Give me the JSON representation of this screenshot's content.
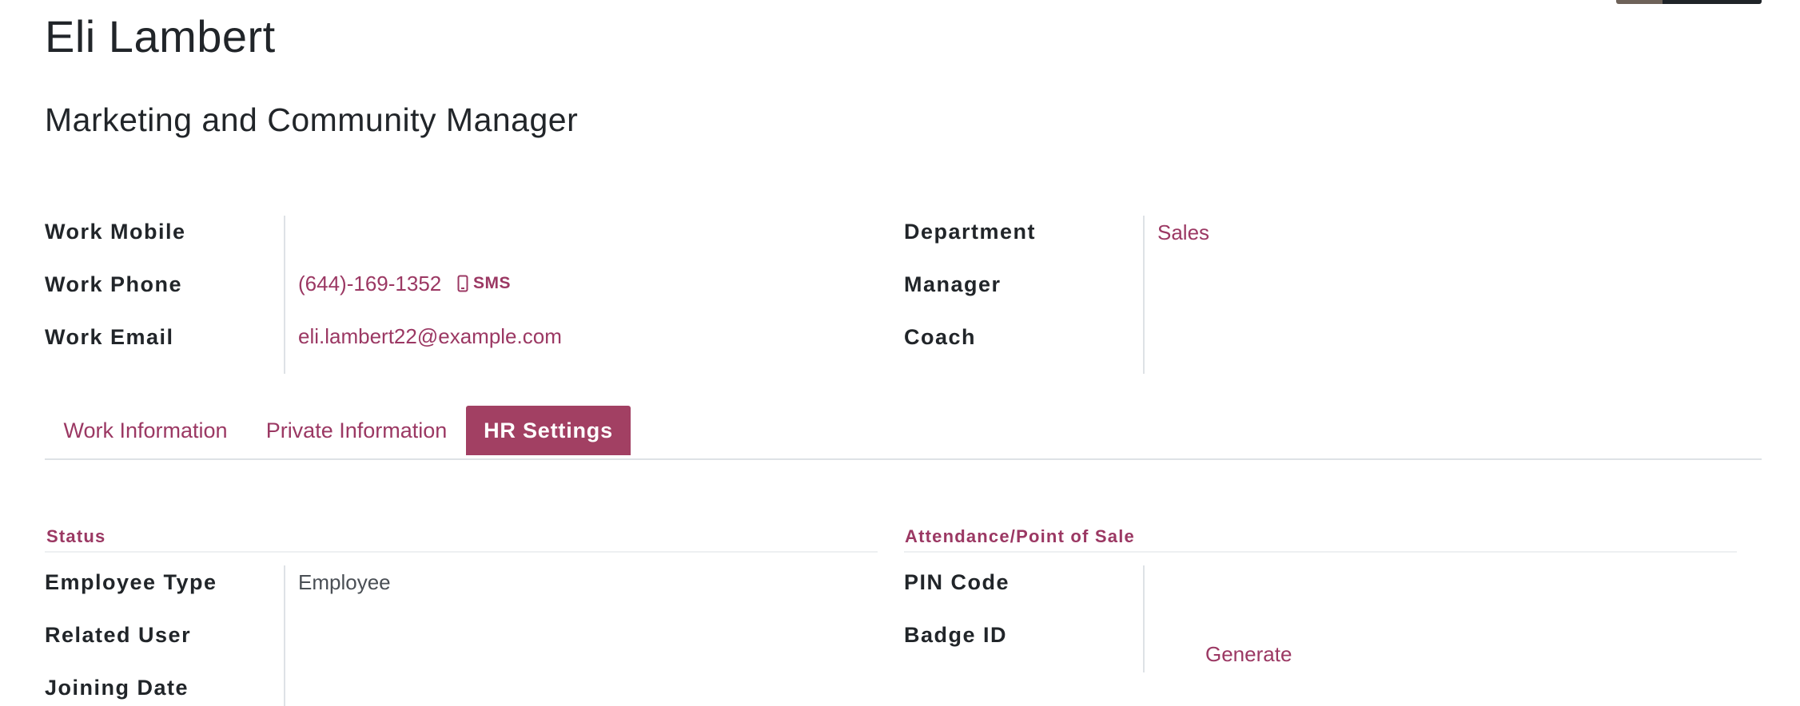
{
  "employee": {
    "name": "Eli Lambert",
    "job_title": "Marketing and Community Manager"
  },
  "contact": {
    "work_mobile_label": "Work Mobile",
    "work_mobile_value": "",
    "work_phone_label": "Work Phone",
    "work_phone_value": "(644)-169-1352",
    "sms_label": "SMS",
    "work_email_label": "Work Email",
    "work_email_value": "eli.lambert22@example.com"
  },
  "org": {
    "department_label": "Department",
    "department_value": "Sales",
    "manager_label": "Manager",
    "manager_value": "",
    "coach_label": "Coach",
    "coach_value": ""
  },
  "tabs": [
    {
      "label": "Work Information",
      "active": false
    },
    {
      "label": "Private Information",
      "active": false
    },
    {
      "label": "HR Settings",
      "active": true
    }
  ],
  "status_group": {
    "title": "Status",
    "employee_type_label": "Employee Type",
    "employee_type_value": "Employee",
    "related_user_label": "Related User",
    "related_user_value": "",
    "joining_date_label": "Joining Date",
    "joining_date_value": ""
  },
  "attendance_group": {
    "title": "Attendance/Point of Sale",
    "pin_code_label": "PIN Code",
    "pin_code_value": "",
    "badge_id_label": "Badge ID",
    "badge_id_value": "",
    "generate_label": "Generate"
  },
  "icons": {
    "sms": "mobile-phone-icon"
  },
  "colors": {
    "accent": "#9b3863",
    "active_tab_bg": "#a24063",
    "text": "#212529",
    "separator": "#dee2e6"
  }
}
